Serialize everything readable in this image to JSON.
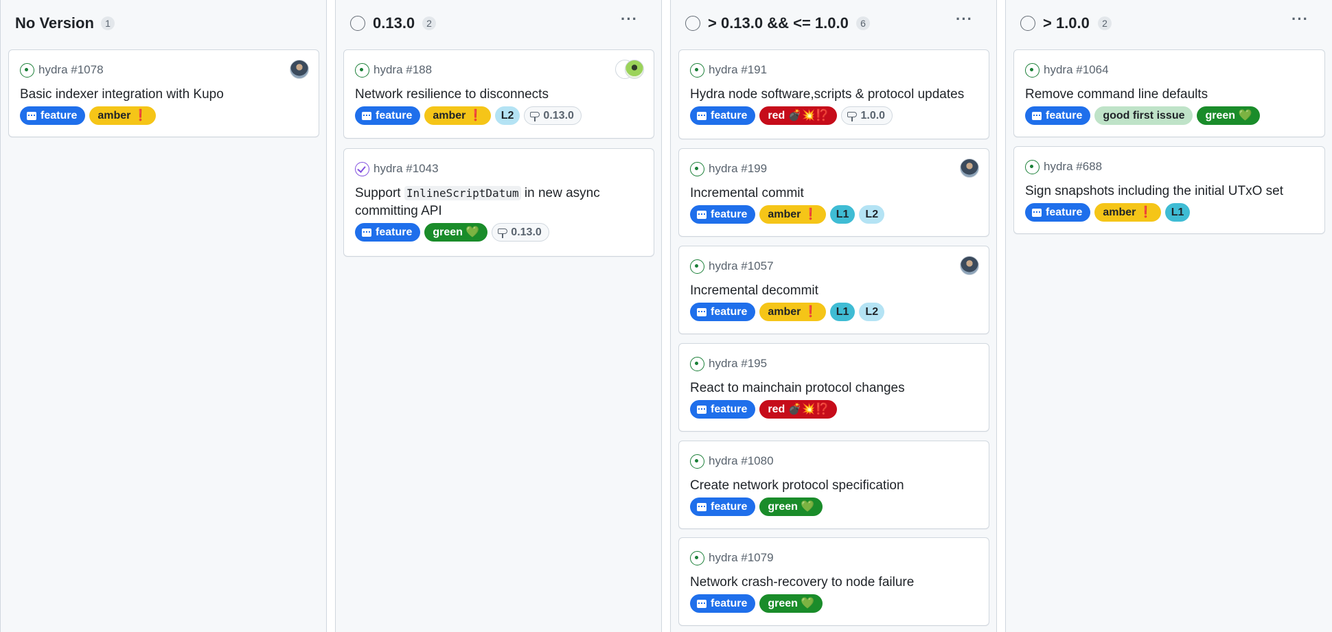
{
  "columns": [
    {
      "title": "No Version",
      "count": "1",
      "cards": [
        {
          "ref": "hydra #1078",
          "title": "Basic indexer integration with Kupo",
          "labels": [
            "feature",
            "amber ❗"
          ]
        }
      ]
    },
    {
      "title": "0.13.0",
      "count": "2",
      "cards": [
        {
          "ref": "hydra #188",
          "title": "Network resilience to disconnects",
          "labels": [
            "feature",
            "amber ❗",
            "L2"
          ],
          "milestone": "0.13.0"
        },
        {
          "ref": "hydra #1043",
          "title_pre": "Support ",
          "title_code": "InlineScriptDatum",
          "title_post": " in new async committing API",
          "labels": [
            "feature",
            "green 💚"
          ],
          "milestone": "0.13.0"
        }
      ]
    },
    {
      "title": "> 0.13.0 && <= 1.0.0",
      "count": "6",
      "cards": [
        {
          "ref": "hydra #191",
          "title": "Hydra node software,scripts & protocol updates",
          "labels": [
            "feature",
            "red 💣💥⁉️"
          ],
          "milestone": "1.0.0"
        },
        {
          "ref": "hydra #199",
          "title": "Incremental commit",
          "labels": [
            "feature",
            "amber ❗",
            "L1",
            "L2"
          ]
        },
        {
          "ref": "hydra #1057",
          "title": "Incremental decommit",
          "labels": [
            "feature",
            "amber ❗",
            "L1",
            "L2"
          ]
        },
        {
          "ref": "hydra #195",
          "title": "React to mainchain protocol changes",
          "labels": [
            "feature",
            "red 💣💥⁉️"
          ]
        },
        {
          "ref": "hydra #1080",
          "title": "Create network protocol specification",
          "labels": [
            "feature",
            "green 💚"
          ]
        },
        {
          "ref": "hydra #1079",
          "title": "Network crash-recovery to node failure",
          "labels": [
            "feature",
            "green 💚"
          ]
        }
      ]
    },
    {
      "title": "> 1.0.0",
      "count": "2",
      "cards": [
        {
          "ref": "hydra #1064",
          "title": "Remove command line defaults",
          "labels": [
            "feature",
            "good first issue",
            "green 💚"
          ]
        },
        {
          "ref": "hydra #688",
          "title": "Sign snapshots including the initial UTxO set",
          "labels": [
            "feature",
            "amber ❗",
            "L1"
          ]
        }
      ]
    }
  ],
  "icons": {
    "status": "circle-icon",
    "issue_open": "issue-opened-icon",
    "issue_closed": "issue-closed-icon",
    "label": "comment-discussion-icon",
    "milestone": "milestone-icon",
    "menu": "kebab-horizontal-icon"
  },
  "colors": {
    "feature": "#1f6feb",
    "amber": "#f5c518",
    "green": "#1a8c2a",
    "red": "#c60c1a",
    "L1": "#3fbcd4",
    "L2": "#b4e3f4",
    "good_first_issue": "#bfe3c8"
  }
}
